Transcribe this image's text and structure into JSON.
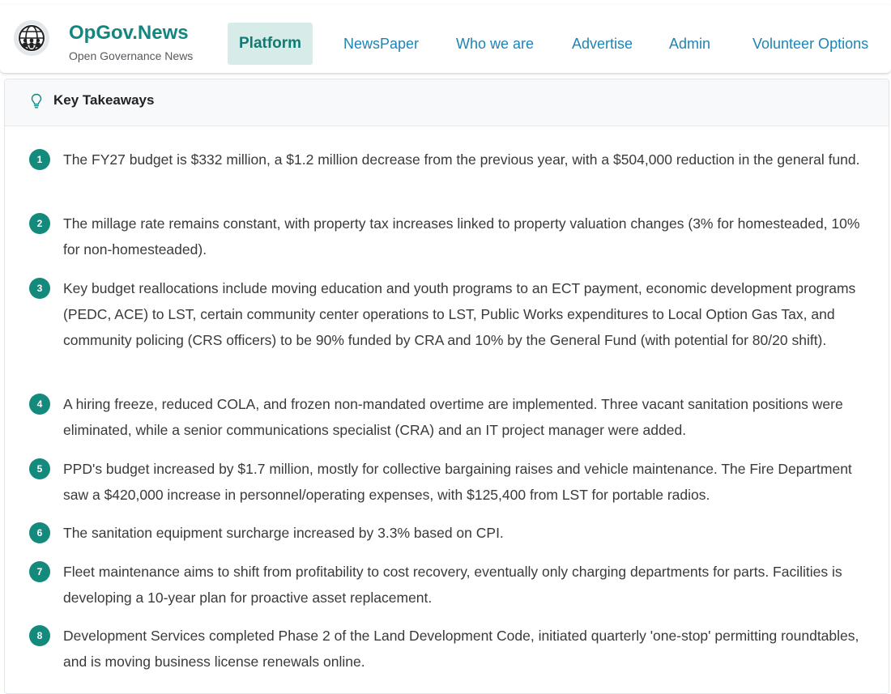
{
  "brand": {
    "name": "OpGov.News",
    "tagline": "Open Governance News"
  },
  "nav": {
    "items": [
      {
        "label": "Platform",
        "active": true
      },
      {
        "label": "NewsPaper"
      },
      {
        "label": "Who we are"
      },
      {
        "label": "Advertise"
      },
      {
        "label": "Admin"
      },
      {
        "label": "Volunteer Options"
      }
    ]
  },
  "card": {
    "title": "Key Takeaways",
    "icon": "lightbulb-icon",
    "items": [
      {
        "num": "1",
        "text": "The FY27 budget is $332 million, a $1.2 million decrease from the previous year, with a $504,000 reduction in the general fund."
      },
      {
        "num": "2",
        "text": "The millage rate remains constant, with property tax increases linked to property valuation changes (3% for homesteaded, 10% for non-homesteaded)."
      },
      {
        "num": "3",
        "text": "Key budget reallocations include moving education and youth programs to an ECT payment, economic development programs (PEDC, ACE) to LST, certain community center operations to LST, Public Works expenditures to Local Option Gas Tax, and community policing (CRS officers) to be 90% funded by CRA and 10% by the General Fund (with potential for 80/20 shift)."
      },
      {
        "num": "4",
        "text": "A hiring freeze, reduced COLA, and frozen non-mandated overtime are implemented. Three vacant sanitation positions were eliminated, while a senior communications specialist (CRA) and an IT project manager were added."
      },
      {
        "num": "5",
        "text": "PPD's budget increased by $1.7 million, mostly for collective bargaining raises and vehicle maintenance. The Fire Department saw a $420,000 increase in personnel/operating expenses, with $125,400 from LST for portable radios."
      },
      {
        "num": "6",
        "text": "The sanitation equipment surcharge increased by 3.3% based on CPI."
      },
      {
        "num": "7",
        "text": "Fleet maintenance aims to shift from profitability to cost recovery, eventually only charging departments for parts. Facilities is developing a 10-year plan for proactive asset replacement."
      },
      {
        "num": "8",
        "text": "Development Services completed Phase 2 of the Land Development Code, initiated quarterly 'one-stop' permitting roundtables, and is moving business license renewals online."
      }
    ]
  },
  "colors": {
    "brand": "#12867f",
    "nav_link": "#1d84b5",
    "active_bg": "#d7ece9",
    "badge": "#138a7c"
  }
}
